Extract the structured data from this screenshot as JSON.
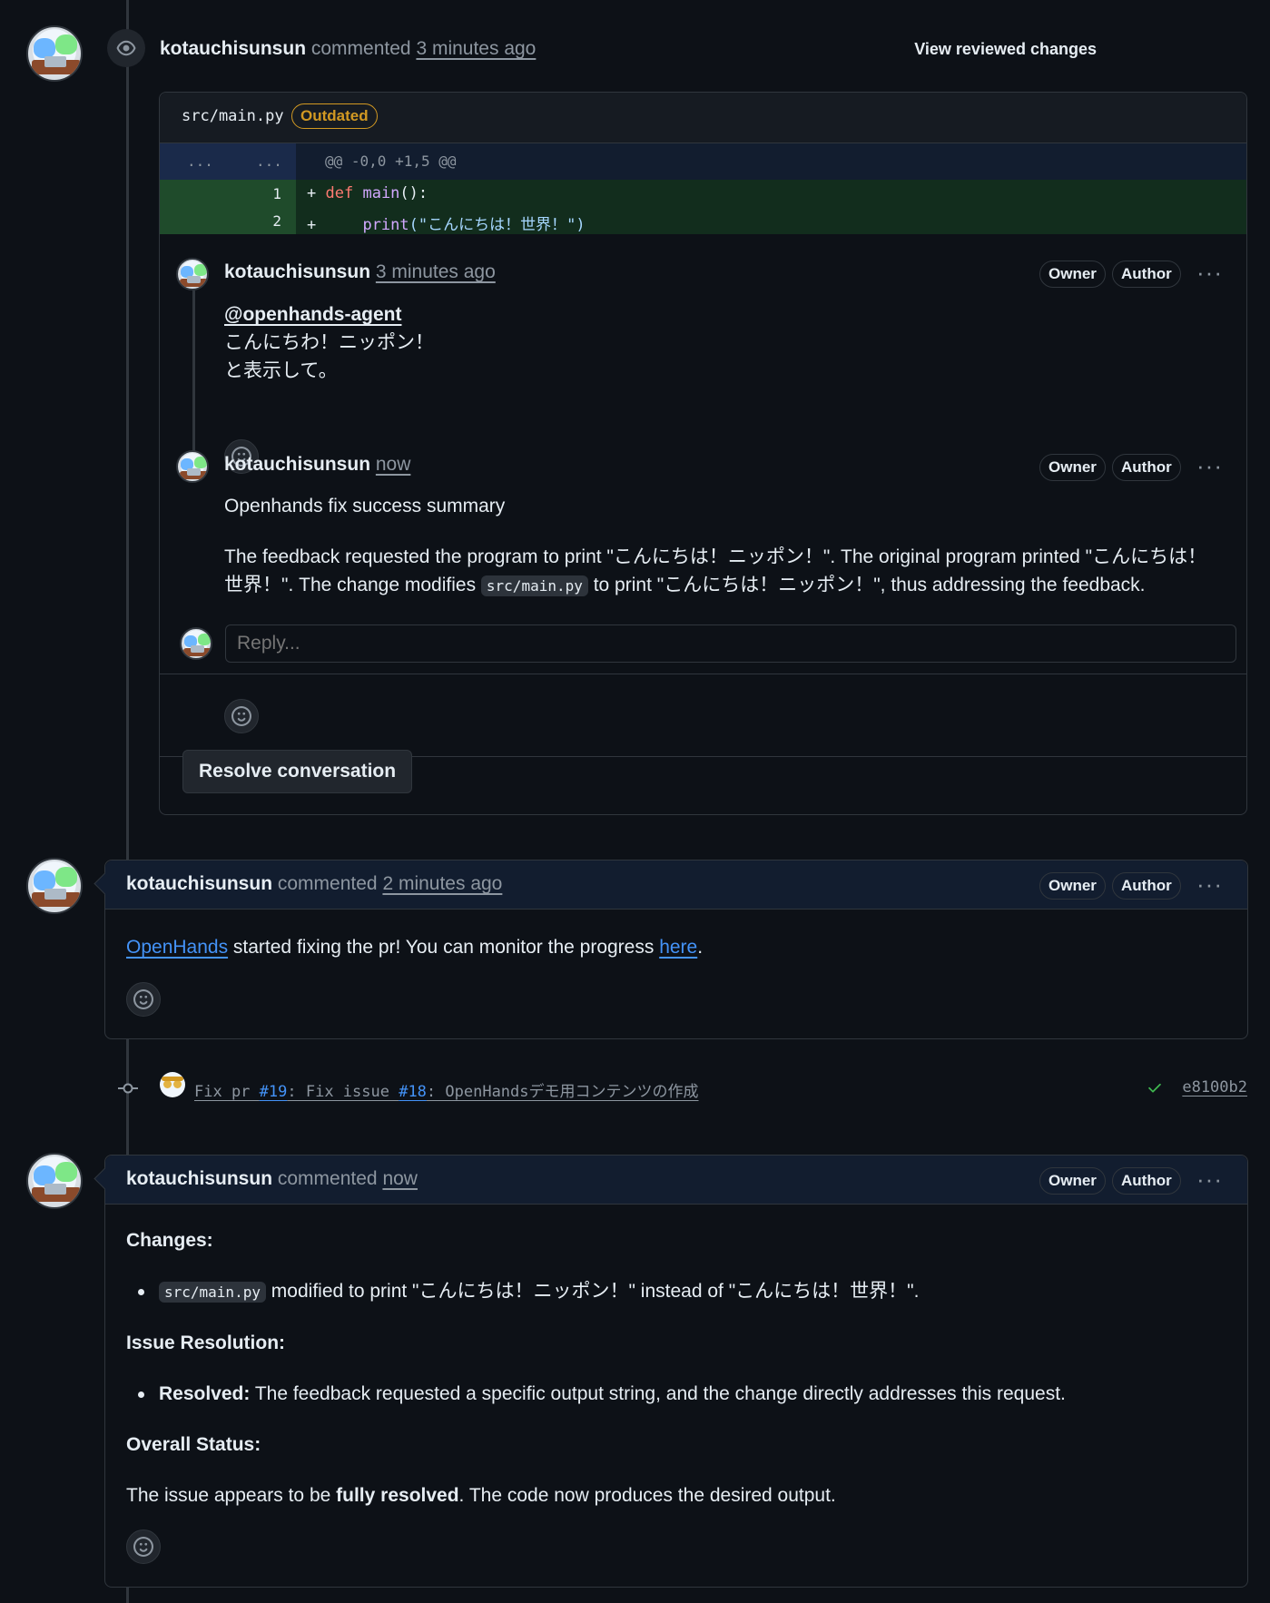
{
  "review": {
    "author": "kotauchisunsun",
    "action": "commented",
    "time": "3 minutes ago",
    "view_changes": "View reviewed changes",
    "file_path": "src/main.py",
    "outdated_label": "Outdated",
    "hunk_left": "...",
    "hunk_right": "...",
    "hunk_header": "@@ -0,0 +1,5 @@",
    "lines": [
      {
        "num": "1",
        "sign": "+",
        "kw": "def",
        "fn": "main",
        "rest": "():"
      },
      {
        "num": "2",
        "sign": "+",
        "indent": "    ",
        "fn": "print",
        "str": "(\"こんにちは！世界！\")"
      }
    ],
    "comments": [
      {
        "author": "kotauchisunsun",
        "time": "3 minutes ago",
        "owner": "Owner",
        "role": "Author",
        "mention": "@openhands-agent",
        "line1": "こんにちわ！ニッポン！",
        "line2": "と表示して。"
      },
      {
        "author": "kotauchisunsun",
        "time": "now",
        "owner": "Owner",
        "role": "Author",
        "title": "Openhands fix success summary",
        "p1a": "The feedback requested the program to print \"こんにちは！ニッポン！\". The original program printed \"こんにちは！",
        "p1b": "世界！\". The change modifies ",
        "p1code": "src/main.py",
        "p1c": " to print \"こんにちは！ニッポン！\", thus addressing the feedback."
      }
    ],
    "reply_placeholder": "Reply...",
    "resolve_label": "Resolve conversation"
  },
  "comment2": {
    "author": "kotauchisunsun",
    "action": "commented",
    "time": "2 minutes ago",
    "owner": "Owner",
    "role": "Author",
    "link1": "OpenHands",
    "text": " started fixing the pr! You can monitor the progress ",
    "link2": "here",
    "end": "."
  },
  "commit": {
    "msg_a": "Fix pr ",
    "ref1": "#19",
    "msg_b": ": Fix issue ",
    "ref2": "#18",
    "msg_c": ": OpenHandsデモ用コンテンツの作成",
    "sha": "e8100b2",
    "status_color": "#3fb950"
  },
  "comment3": {
    "author": "kotauchisunsun",
    "action": "commented",
    "time": "now",
    "owner": "Owner",
    "role": "Author",
    "changes_heading": "Changes:",
    "change_code": "src/main.py",
    "change_text": " modified to print \"こんにちは！ニッポン！\" instead of \"こんにちは！世界！\".",
    "resolution_heading": "Issue Resolution:",
    "resolved_label": "Resolved:",
    "resolved_text": " The feedback requested a specific output string, and the change directly addresses this request.",
    "status_heading": "Overall Status:",
    "status_a": "The issue appears to be ",
    "status_bold": "fully resolved",
    "status_b": ". The code now produces the desired output."
  },
  "colors": {
    "background": "#0d1117",
    "border": "#30363d",
    "link": "#4493f8",
    "outdated": "#d29922",
    "diff_add": "#122d1d"
  },
  "icons": [
    "eye-icon",
    "smiley-icon",
    "kebab-icon",
    "commit-icon",
    "check-icon"
  ]
}
